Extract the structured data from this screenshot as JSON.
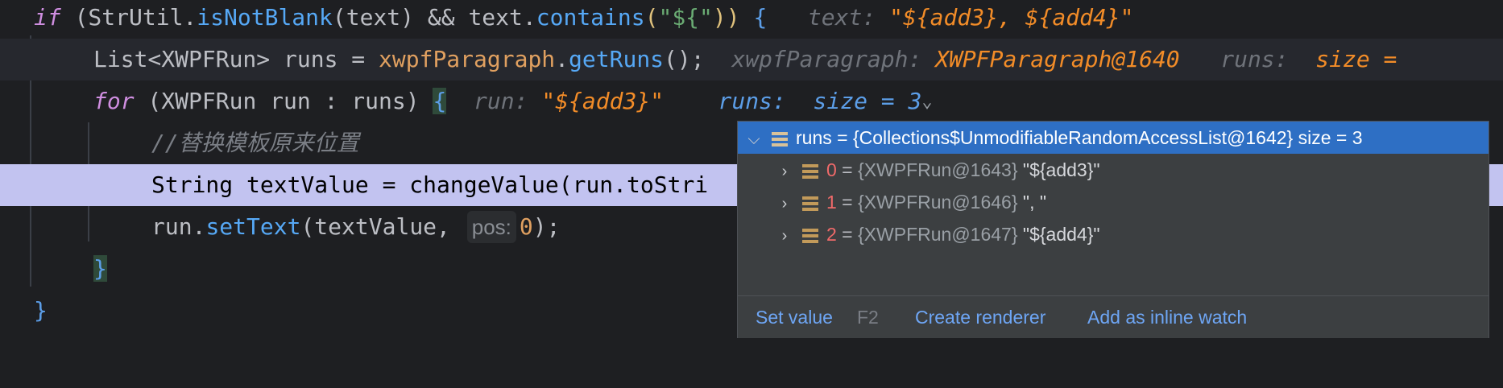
{
  "code": {
    "line1": {
      "kw_if": "if",
      "p1": " (StrUtil.",
      "fn1": "isNotBlank",
      "p2": "(text) && text.",
      "fn2": "contains",
      "p3": "(",
      "str": "\"${\"",
      "p4": ")) ",
      "brace": "{",
      "hint_label": "text:",
      "hint_val": "\"${add3}, ${add4}\""
    },
    "line2": {
      "p1": "List<XWPFRun> runs = ",
      "var": "xwpfParagraph",
      "p2": ".",
      "fn": "getRuns",
      "p3": "();",
      "hint_label1": "xwpfParagraph:",
      "hint_val1": "XWPFParagraph@1640",
      "hint_label2": "runs:",
      "hint_val2": "size ="
    },
    "line3": {
      "kw_for": "for",
      "p1": " (XWPFRun run : runs) ",
      "brace": "{",
      "hint_label1": "run:",
      "hint_val1": "\"${add3}\"",
      "hint_label2": "runs:",
      "hint_val2": "size = 3"
    },
    "line4": {
      "comment": "//替换模板原来位置"
    },
    "line5": {
      "text": "String textValue = changeValue(run.toStri"
    },
    "line6": {
      "p1": "run.",
      "fn": "setText",
      "p2": "(textValue, ",
      "param_hint": "pos:",
      "num": "0",
      "p3": ");"
    },
    "line7": {
      "brace": "}"
    },
    "line8": {
      "brace": "}"
    }
  },
  "popup": {
    "root": {
      "label": "runs = {Collections$UnmodifiableRandomAccessList@1642}",
      "size": "size = 3"
    },
    "items": [
      {
        "index": "0",
        "eq": " = ",
        "ref": "{XWPFRun@1643}",
        "value": "\"${add3}\""
      },
      {
        "index": "1",
        "eq": " = ",
        "ref": "{XWPFRun@1646}",
        "value": "\", \""
      },
      {
        "index": "2",
        "eq": " = ",
        "ref": "{XWPFRun@1647}",
        "value": "\"${add4}\""
      }
    ],
    "footer": {
      "set_value": "Set value",
      "set_value_key": "F2",
      "create_renderer": "Create renderer",
      "add_inline_watch": "Add as inline watch"
    }
  },
  "icons": {
    "expand_down": "chevron-down-icon",
    "expand_right": "chevron-right-icon",
    "list": "list-icon"
  },
  "colors": {
    "background": "#1e1f22",
    "exec_line": "#c2c3f0",
    "popup_bg": "#3c3f41",
    "selection": "#2e6fc4",
    "link": "#6ea6f5"
  }
}
